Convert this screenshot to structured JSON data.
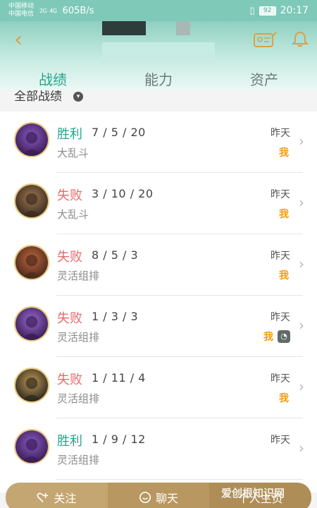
{
  "status_bar": {
    "carrier_1": "中国移动",
    "carrier_2": "中国电信",
    "signal_1": "2G",
    "signal_2": "4G",
    "speed": "605B/s",
    "battery": "92",
    "time": "20:17"
  },
  "header": {
    "tabs": [
      {
        "label": "战绩",
        "active": true
      },
      {
        "label": "能力",
        "active": false
      },
      {
        "label": "资产",
        "active": false
      }
    ]
  },
  "filter": {
    "label": "全部战绩"
  },
  "matches": [
    {
      "result": "胜利",
      "win": true,
      "kda": "7 / 5 / 20",
      "mode": "大乱斗",
      "date": "昨天",
      "badge_me": "我",
      "team": false
    },
    {
      "result": "失败",
      "win": false,
      "kda": "3 / 10 / 20",
      "mode": "大乱斗",
      "date": "昨天",
      "badge_me": "我",
      "team": false
    },
    {
      "result": "失败",
      "win": false,
      "kda": "8 / 5 / 3",
      "mode": "灵活组排",
      "date": "昨天",
      "badge_me": "我",
      "team": false
    },
    {
      "result": "失败",
      "win": false,
      "kda": "1 / 3 / 3",
      "mode": "灵活组排",
      "date": "昨天",
      "badge_me": "我",
      "team": true
    },
    {
      "result": "失败",
      "win": false,
      "kda": "1 / 11 / 4",
      "mode": "灵活组排",
      "date": "昨天",
      "badge_me": "我",
      "team": false
    },
    {
      "result": "胜利",
      "win": true,
      "kda": "1 / 9 / 12",
      "mode": "灵活组排",
      "date": "昨天",
      "badge_me": "",
      "team": false
    }
  ],
  "bottom_bar": {
    "follow_label": "关注",
    "chat_label": "聊天",
    "profile_label": "个人主页"
  },
  "watermark": "爱创根知识网",
  "colors": {
    "accent": "#23a68d",
    "win": "#23a68d",
    "lose": "#e56c6c",
    "me_badge": "#f29a12",
    "gold": "#d8a24a"
  }
}
